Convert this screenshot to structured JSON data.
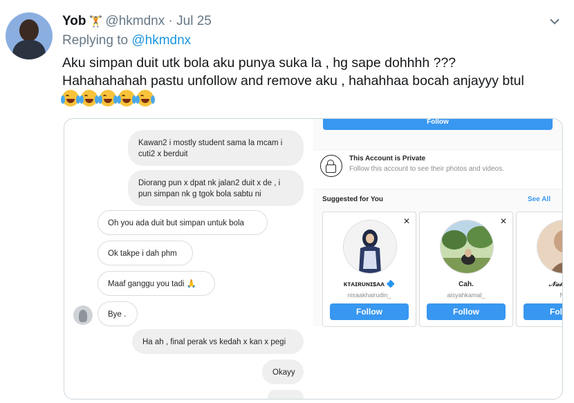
{
  "tweet": {
    "name": "Yob",
    "name_emoji": "🏋",
    "handle": "@hkmdnx",
    "dot": "·",
    "date": "Jul 25",
    "replying_prefix": "Replying to",
    "replying_handle": "@hkmdnx",
    "line1": "Aku simpan duit utk bola aku punya suka la , hg sape dohhhh ???",
    "line2": "Hahahahahah pastu unfollow and remove aku , hahahhaa bocah anjayyy btul",
    "emoji_count": 5
  },
  "chat": {
    "messages": [
      {
        "text": "Kawan2 i mostly student sama la mcam i cuti2 x berduit",
        "from": "me"
      },
      {
        "text": "Diorang pun x dpat nk jalan2 duit x de , i pun simpan nk g tgok bola sabtu ni",
        "from": "me"
      },
      {
        "text": "Oh you ada duit but simpan untuk bola",
        "from": "them"
      },
      {
        "text": "Ok takpe i dah phm",
        "from": "them"
      },
      {
        "text": "Maaf ganggu you tadi 🙏",
        "from": "them"
      },
      {
        "text": "Bye .",
        "from": "them"
      },
      {
        "text": "Ha ah , final perak vs kedah x kan x pegi",
        "from": "me"
      },
      {
        "text": "Okayy",
        "from": "me"
      }
    ]
  },
  "instagram": {
    "follow_top": "Follow",
    "private_title": "This Account is Private",
    "private_sub": "Follow this account to see their photos and videos.",
    "suggested": "Suggested for You",
    "see_all": "See All",
    "cards": [
      {
        "name": "ĸᴛᴀɪʀᴜɴɪꜱᴀᴀ 🔷",
        "user": "nisaakhairudin_",
        "button": "Follow"
      },
      {
        "name": "Cah.",
        "user": "aisyahkamal_",
        "button": "Follow"
      },
      {
        "name": "𝒩𝒶𝓉𝑒𝑔𝓇𝒾𝓃",
        "user": "N.",
        "button": "Follow"
      }
    ]
  }
}
